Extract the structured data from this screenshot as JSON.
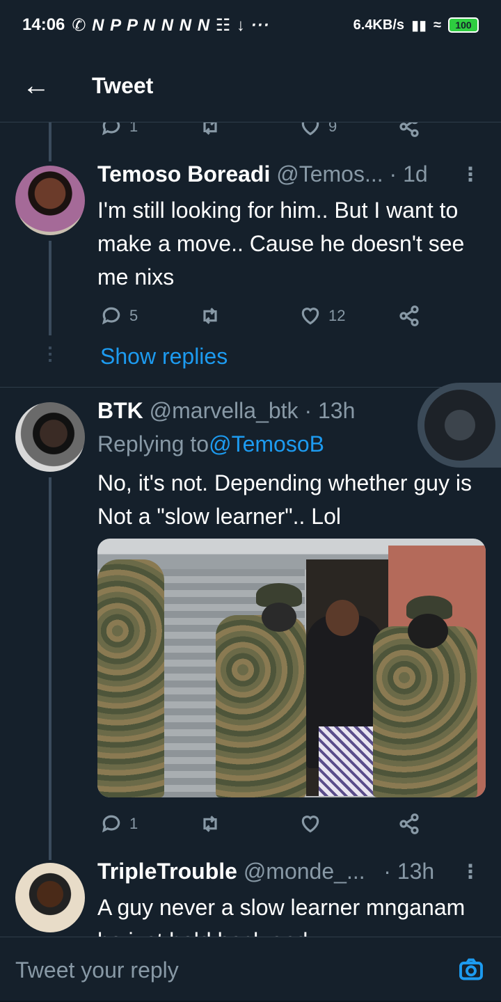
{
  "status_bar": {
    "time": "14:06",
    "notif_icons": "✆ N P P N N N N ☷ ↓ ···",
    "net_speed": "6.4KB/s",
    "battery": "100"
  },
  "header": {
    "title": "Tweet"
  },
  "top_actions": {
    "reply_count": "1",
    "like_count": "9"
  },
  "tweets": [
    {
      "name": "Temoso Boreadi",
      "handle": "@Temos...",
      "time": "· 1d",
      "text": "I'm still looking for him.. But I want to make a move.. Cause he doesn't see me nixs",
      "reply_count": "5",
      "retweet_count": "",
      "like_count": "12",
      "show_replies": "Show replies"
    },
    {
      "name": "BTK",
      "handle": "@marvella_btk",
      "time": "· 13h",
      "replying_prefix": "Replying to ",
      "replying_to": "@TemosoB",
      "text": "No, it's not. Depending whether guy is Not a \"slow learner\".. Lol",
      "reply_count": "1",
      "retweet_count": "",
      "like_count": ""
    },
    {
      "name": "TripleTrouble",
      "handle": "@monde_...",
      "time": "· 13h",
      "text": "A guy never a slow learner mnganam he just hold back and"
    }
  ],
  "reply_bar": {
    "placeholder": "Tweet your reply"
  },
  "colors": {
    "background": "#15202b",
    "accent": "#1d9bf0",
    "muted": "#8899a6"
  },
  "icons": [
    "back-arrow-icon",
    "reply-icon",
    "retweet-icon",
    "like-icon",
    "share-icon",
    "more-icon",
    "camera-icon"
  ]
}
